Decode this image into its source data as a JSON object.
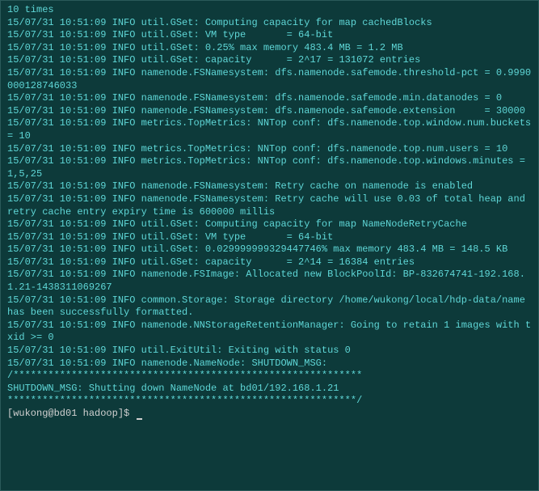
{
  "terminal": {
    "lines": [
      "10 times",
      "15/07/31 10:51:09 INFO util.GSet: Computing capacity for map cachedBlocks",
      "15/07/31 10:51:09 INFO util.GSet: VM type       = 64-bit",
      "15/07/31 10:51:09 INFO util.GSet: 0.25% max memory 483.4 MB = 1.2 MB",
      "15/07/31 10:51:09 INFO util.GSet: capacity      = 2^17 = 131072 entries",
      "15/07/31 10:51:09 INFO namenode.FSNamesystem: dfs.namenode.safemode.threshold-pct = 0.9990000128746033",
      "15/07/31 10:51:09 INFO namenode.FSNamesystem: dfs.namenode.safemode.min.datanodes = 0",
      "15/07/31 10:51:09 INFO namenode.FSNamesystem: dfs.namenode.safemode.extension     = 30000",
      "15/07/31 10:51:09 INFO metrics.TopMetrics: NNTop conf: dfs.namenode.top.window.num.buckets = 10",
      "15/07/31 10:51:09 INFO metrics.TopMetrics: NNTop conf: dfs.namenode.top.num.users = 10",
      "15/07/31 10:51:09 INFO metrics.TopMetrics: NNTop conf: dfs.namenode.top.windows.minutes = 1,5,25",
      "15/07/31 10:51:09 INFO namenode.FSNamesystem: Retry cache on namenode is enabled",
      "15/07/31 10:51:09 INFO namenode.FSNamesystem: Retry cache will use 0.03 of total heap and retry cache entry expiry time is 600000 millis",
      "15/07/31 10:51:09 INFO util.GSet: Computing capacity for map NameNodeRetryCache",
      "15/07/31 10:51:09 INFO util.GSet: VM type       = 64-bit",
      "15/07/31 10:51:09 INFO util.GSet: 0.029999999329447746% max memory 483.4 MB = 148.5 KB",
      "15/07/31 10:51:09 INFO util.GSet: capacity      = 2^14 = 16384 entries",
      "15/07/31 10:51:09 INFO namenode.FSImage: Allocated new BlockPoolId: BP-832674741-192.168.1.21-1438311069267",
      "15/07/31 10:51:09 INFO common.Storage: Storage directory /home/wukong/local/hdp-data/name has been successfully formatted.",
      "15/07/31 10:51:09 INFO namenode.NNStorageRetentionManager: Going to retain 1 images with txid >= 0",
      "15/07/31 10:51:09 INFO util.ExitUtil: Exiting with status 0",
      "15/07/31 10:51:09 INFO namenode.NameNode: SHUTDOWN_MSG:",
      "/************************************************************",
      "SHUTDOWN_MSG: Shutting down NameNode at bd01/192.168.1.21",
      "************************************************************/"
    ],
    "prompt": "[wukong@bd01 hadoop]$ "
  }
}
